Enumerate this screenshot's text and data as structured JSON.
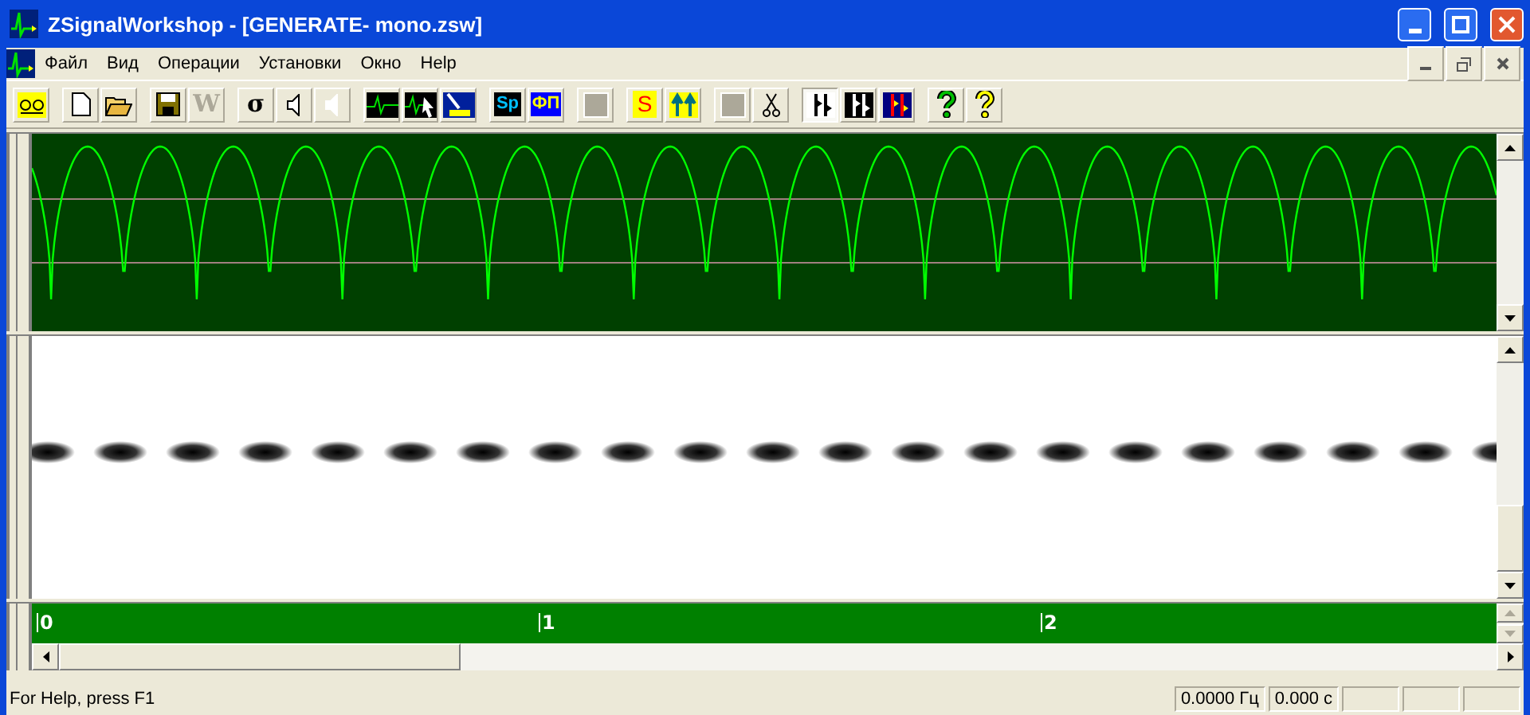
{
  "window": {
    "title": "ZSignalWorkshop - [GENERATE- mono.zsw]"
  },
  "menu": [
    "Файл",
    "Вид",
    "Операции",
    "Установки",
    "Окно",
    "Help"
  ],
  "toolbar": [
    {
      "kind": "cassette"
    },
    {
      "kind": "sep"
    },
    {
      "kind": "new"
    },
    {
      "kind": "open"
    },
    {
      "kind": "sep"
    },
    {
      "kind": "save"
    },
    {
      "kind": "letter",
      "label": "W",
      "disabled": true
    },
    {
      "kind": "sep"
    },
    {
      "kind": "letter",
      "label": "σ",
      "disabled": false
    },
    {
      "kind": "speaker",
      "disabled": false
    },
    {
      "kind": "speaker",
      "disabled": true
    },
    {
      "kind": "sep"
    },
    {
      "kind": "wave"
    },
    {
      "kind": "wavecursor"
    },
    {
      "kind": "scope"
    },
    {
      "kind": "sep"
    },
    {
      "kind": "tag",
      "label": "Sp"
    },
    {
      "kind": "tag",
      "label": "ФП"
    },
    {
      "kind": "sep"
    },
    {
      "kind": "blank"
    },
    {
      "kind": "sep"
    },
    {
      "kind": "redletter",
      "label": "S"
    },
    {
      "kind": "arrows"
    },
    {
      "kind": "sep"
    },
    {
      "kind": "blank"
    },
    {
      "kind": "scissors"
    },
    {
      "kind": "sep"
    },
    {
      "kind": "marks",
      "pressed": true
    },
    {
      "kind": "marks",
      "pressed": false
    },
    {
      "kind": "marksblue",
      "pressed": false
    },
    {
      "kind": "sep"
    },
    {
      "kind": "help",
      "color": "#00c000"
    },
    {
      "kind": "help",
      "color": "#ffff00"
    }
  ],
  "ruler": [
    "0",
    "1",
    "2"
  ],
  "status": {
    "text": "For Help, press F1",
    "panels": [
      "0.0000 Гц",
      "0.000 с"
    ]
  }
}
